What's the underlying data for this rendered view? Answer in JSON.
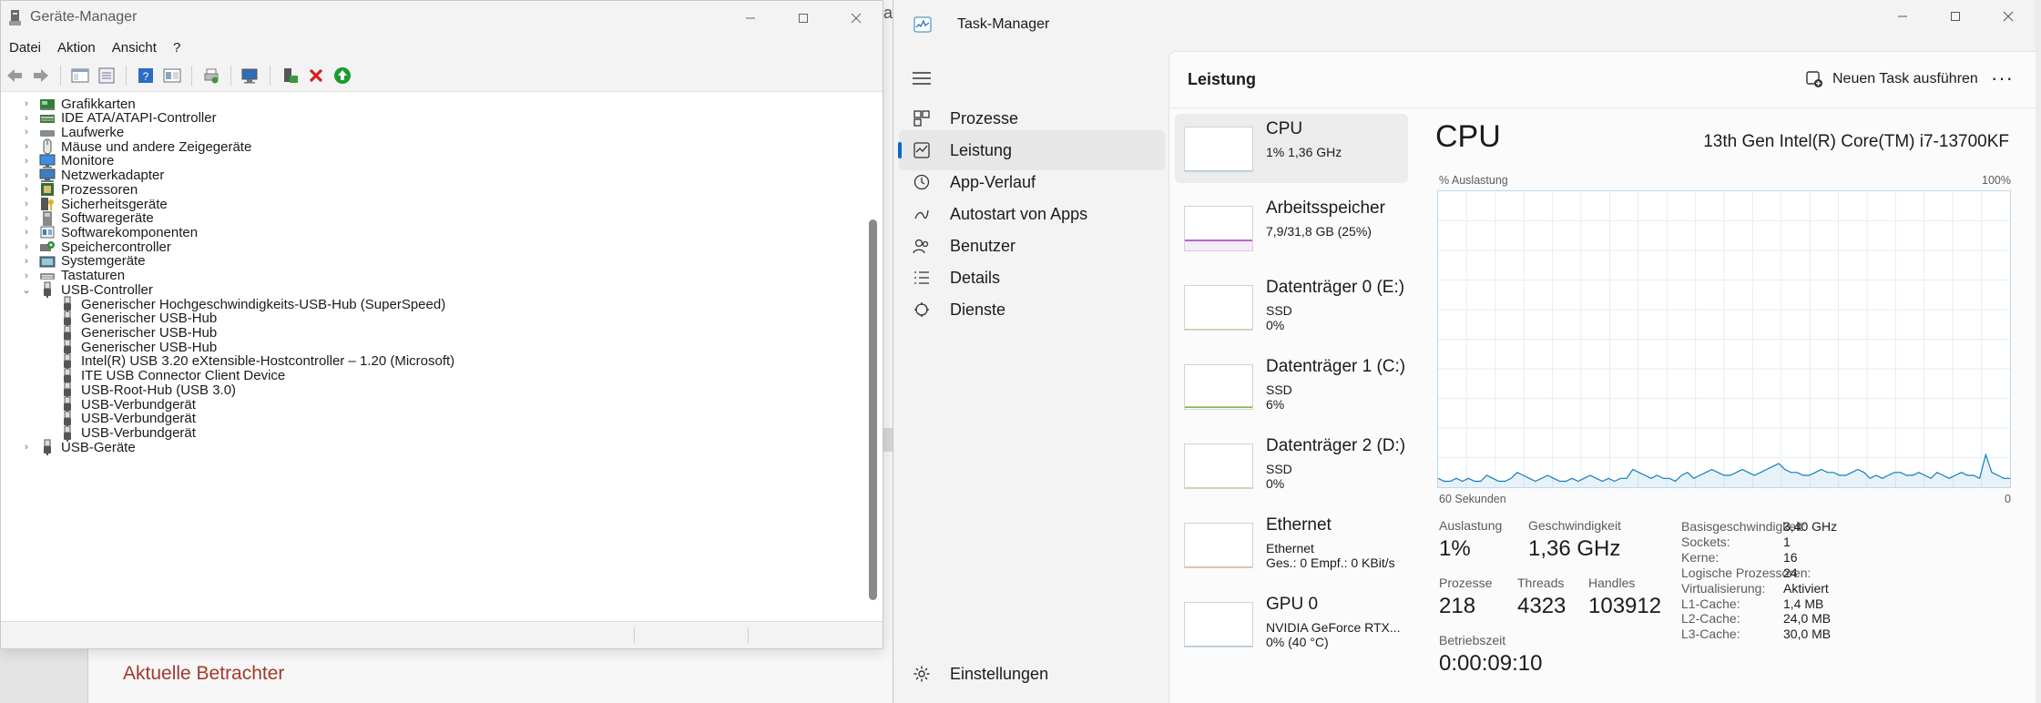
{
  "background": {
    "link_text": "Aktuelle Betrachter",
    "peek_char": "a"
  },
  "device_manager": {
    "title": "Geräte-Manager",
    "menu": [
      "Datei",
      "Aktion",
      "Ansicht",
      "?"
    ],
    "tree": [
      {
        "label": "Grafikkarten",
        "icon": "display-adapter-icon",
        "level": 0,
        "expanded": false
      },
      {
        "label": "IDE ATA/ATAPI-Controller",
        "icon": "ide-controller-icon",
        "level": 0,
        "expanded": false
      },
      {
        "label": "Laufwerke",
        "icon": "drive-icon",
        "level": 0,
        "expanded": false
      },
      {
        "label": "Mäuse und andere Zeigegeräte",
        "icon": "mouse-icon",
        "level": 0,
        "expanded": false
      },
      {
        "label": "Monitore",
        "icon": "monitor-icon",
        "level": 0,
        "expanded": false
      },
      {
        "label": "Netzwerkadapter",
        "icon": "network-adapter-icon",
        "level": 0,
        "expanded": false
      },
      {
        "label": "Prozessoren",
        "icon": "processor-icon",
        "level": 0,
        "expanded": false
      },
      {
        "label": "Sicherheitsgeräte",
        "icon": "security-device-icon",
        "level": 0,
        "expanded": false
      },
      {
        "label": "Softwaregeräte",
        "icon": "software-device-icon",
        "level": 0,
        "expanded": false
      },
      {
        "label": "Softwarekomponenten",
        "icon": "software-component-icon",
        "level": 0,
        "expanded": false
      },
      {
        "label": "Speichercontroller",
        "icon": "storage-controller-icon",
        "level": 0,
        "expanded": false
      },
      {
        "label": "Systemgeräte",
        "icon": "system-device-icon",
        "level": 0,
        "expanded": false
      },
      {
        "label": "Tastaturen",
        "icon": "keyboard-icon",
        "level": 0,
        "expanded": false
      },
      {
        "label": "USB-Controller",
        "icon": "usb-icon",
        "level": 0,
        "expanded": true
      },
      {
        "label": "Generischer Hochgeschwindigkeits-USB-Hub (SuperSpeed)",
        "icon": "usb-icon",
        "level": 1
      },
      {
        "label": "Generischer USB-Hub",
        "icon": "usb-icon",
        "level": 1
      },
      {
        "label": "Generischer USB-Hub",
        "icon": "usb-icon",
        "level": 1
      },
      {
        "label": "Generischer USB-Hub",
        "icon": "usb-icon",
        "level": 1
      },
      {
        "label": "Intel(R) USB 3.20 eXtensible-Hostcontroller – 1.20 (Microsoft)",
        "icon": "usb-icon",
        "level": 1
      },
      {
        "label": "ITE USB Connector Client Device",
        "icon": "usb-icon",
        "level": 1
      },
      {
        "label": "USB-Root-Hub (USB 3.0)",
        "icon": "usb-icon",
        "level": 1
      },
      {
        "label": "USB-Verbundgerät",
        "icon": "usb-icon",
        "level": 1
      },
      {
        "label": "USB-Verbundgerät",
        "icon": "usb-icon",
        "level": 1
      },
      {
        "label": "USB-Verbundgerät",
        "icon": "usb-icon",
        "level": 1
      },
      {
        "label": "USB-Geräte",
        "icon": "usb-icon",
        "level": 0,
        "expanded": false
      }
    ]
  },
  "task_manager": {
    "title": "Task-Manager",
    "nav": [
      {
        "label": "Prozesse",
        "icon": "processes-icon",
        "active": false
      },
      {
        "label": "Leistung",
        "icon": "performance-icon",
        "active": true
      },
      {
        "label": "App-Verlauf",
        "icon": "history-icon",
        "active": false
      },
      {
        "label": "Autostart von Apps",
        "icon": "startup-icon",
        "active": false
      },
      {
        "label": "Benutzer",
        "icon": "users-icon",
        "active": false
      },
      {
        "label": "Details",
        "icon": "details-icon",
        "active": false
      },
      {
        "label": "Dienste",
        "icon": "services-icon",
        "active": false
      }
    ],
    "settings_label": "Einstellungen",
    "page_title": "Leistung",
    "new_task_label": "Neuen Task ausführen",
    "more_label": "···",
    "resources": [
      {
        "name": "CPU",
        "lines": [
          "1%  1,36 GHz"
        ],
        "color": "#117dbb",
        "active": true,
        "usage": 0.01
      },
      {
        "name": "Arbeitsspeicher",
        "lines": [
          "7,9/31,8 GB (25%)"
        ],
        "color": "#8b12ae",
        "active": false,
        "usage": 0.25
      },
      {
        "name": "Datenträger 0 (E:)",
        "lines": [
          "SSD",
          "0%"
        ],
        "color": "#4da60c",
        "active": false,
        "usage": 0
      },
      {
        "name": "Datenträger 1 (C:)",
        "lines": [
          "SSD",
          "6%"
        ],
        "color": "#4da60c",
        "active": false,
        "usage": 0.06
      },
      {
        "name": "Datenträger 2 (D:)",
        "lines": [
          "SSD",
          "0%"
        ],
        "color": "#4da60c",
        "active": false,
        "usage": 0
      },
      {
        "name": "Ethernet",
        "lines": [
          "Ethernet",
          "Ges.: 0  Empf.: 0 KBit/s"
        ],
        "color": "#a74f01",
        "active": false,
        "usage": 0
      },
      {
        "name": "GPU 0",
        "lines": [
          "NVIDIA GeForce RTX...",
          "0%  (40 °C)"
        ],
        "color": "#117dbb",
        "active": false,
        "usage": 0
      }
    ],
    "cpu": {
      "title": "CPU",
      "model": "13th Gen Intel(R) Core(TM) i7-13700KF",
      "graph_ylabel": "% Auslastung",
      "graph_ymax_label": "100%",
      "graph_xlabel": "60 Sekunden",
      "graph_xmin_label": "0",
      "graph_color": "#117dbb",
      "utilization_history_percent": [
        3,
        2,
        2,
        3,
        2,
        3,
        2,
        2,
        4,
        3,
        2,
        2,
        3,
        5,
        4,
        3,
        2,
        3,
        4,
        3,
        2,
        2,
        3,
        2,
        3,
        4,
        3,
        2,
        3,
        2,
        3,
        3,
        6,
        5,
        4,
        3,
        4,
        3,
        3,
        2,
        4,
        5,
        3,
        4,
        5,
        6,
        5,
        4,
        4,
        5,
        6,
        5,
        4,
        5,
        6,
        7,
        8,
        6,
        5,
        5,
        4,
        4,
        5,
        6,
        5,
        5,
        4,
        4,
        5,
        6,
        5,
        3,
        4,
        3,
        4,
        5,
        5,
        4,
        4,
        5,
        4,
        3,
        5,
        4,
        3,
        4,
        5,
        4,
        4,
        3,
        11,
        5,
        4,
        3,
        3
      ],
      "stats": [
        {
          "label": "Auslastung",
          "value": "1%"
        },
        {
          "label": "Geschwindigkeit",
          "value": "1,36 GHz"
        },
        {
          "label": "Prozesse",
          "value": "218"
        },
        {
          "label": "Threads",
          "value": "4323"
        },
        {
          "label": "Handles",
          "value": "103912"
        },
        {
          "label": "Betriebszeit",
          "value": "0:00:09:10"
        }
      ],
      "specs": [
        {
          "key": "Basisgeschwindigkeit:",
          "value": "3,40 GHz"
        },
        {
          "key": "Sockets:",
          "value": "1"
        },
        {
          "key": "Kerne:",
          "value": "16"
        },
        {
          "key": "Logische Prozessoren:",
          "value": "24"
        },
        {
          "key": "Virtualisierung:",
          "value": "Aktiviert"
        },
        {
          "key": "L1-Cache:",
          "value": "1,4 MB"
        },
        {
          "key": "L2-Cache:",
          "value": "24,0 MB"
        },
        {
          "key": "L3-Cache:",
          "value": "30,0 MB"
        }
      ]
    }
  }
}
